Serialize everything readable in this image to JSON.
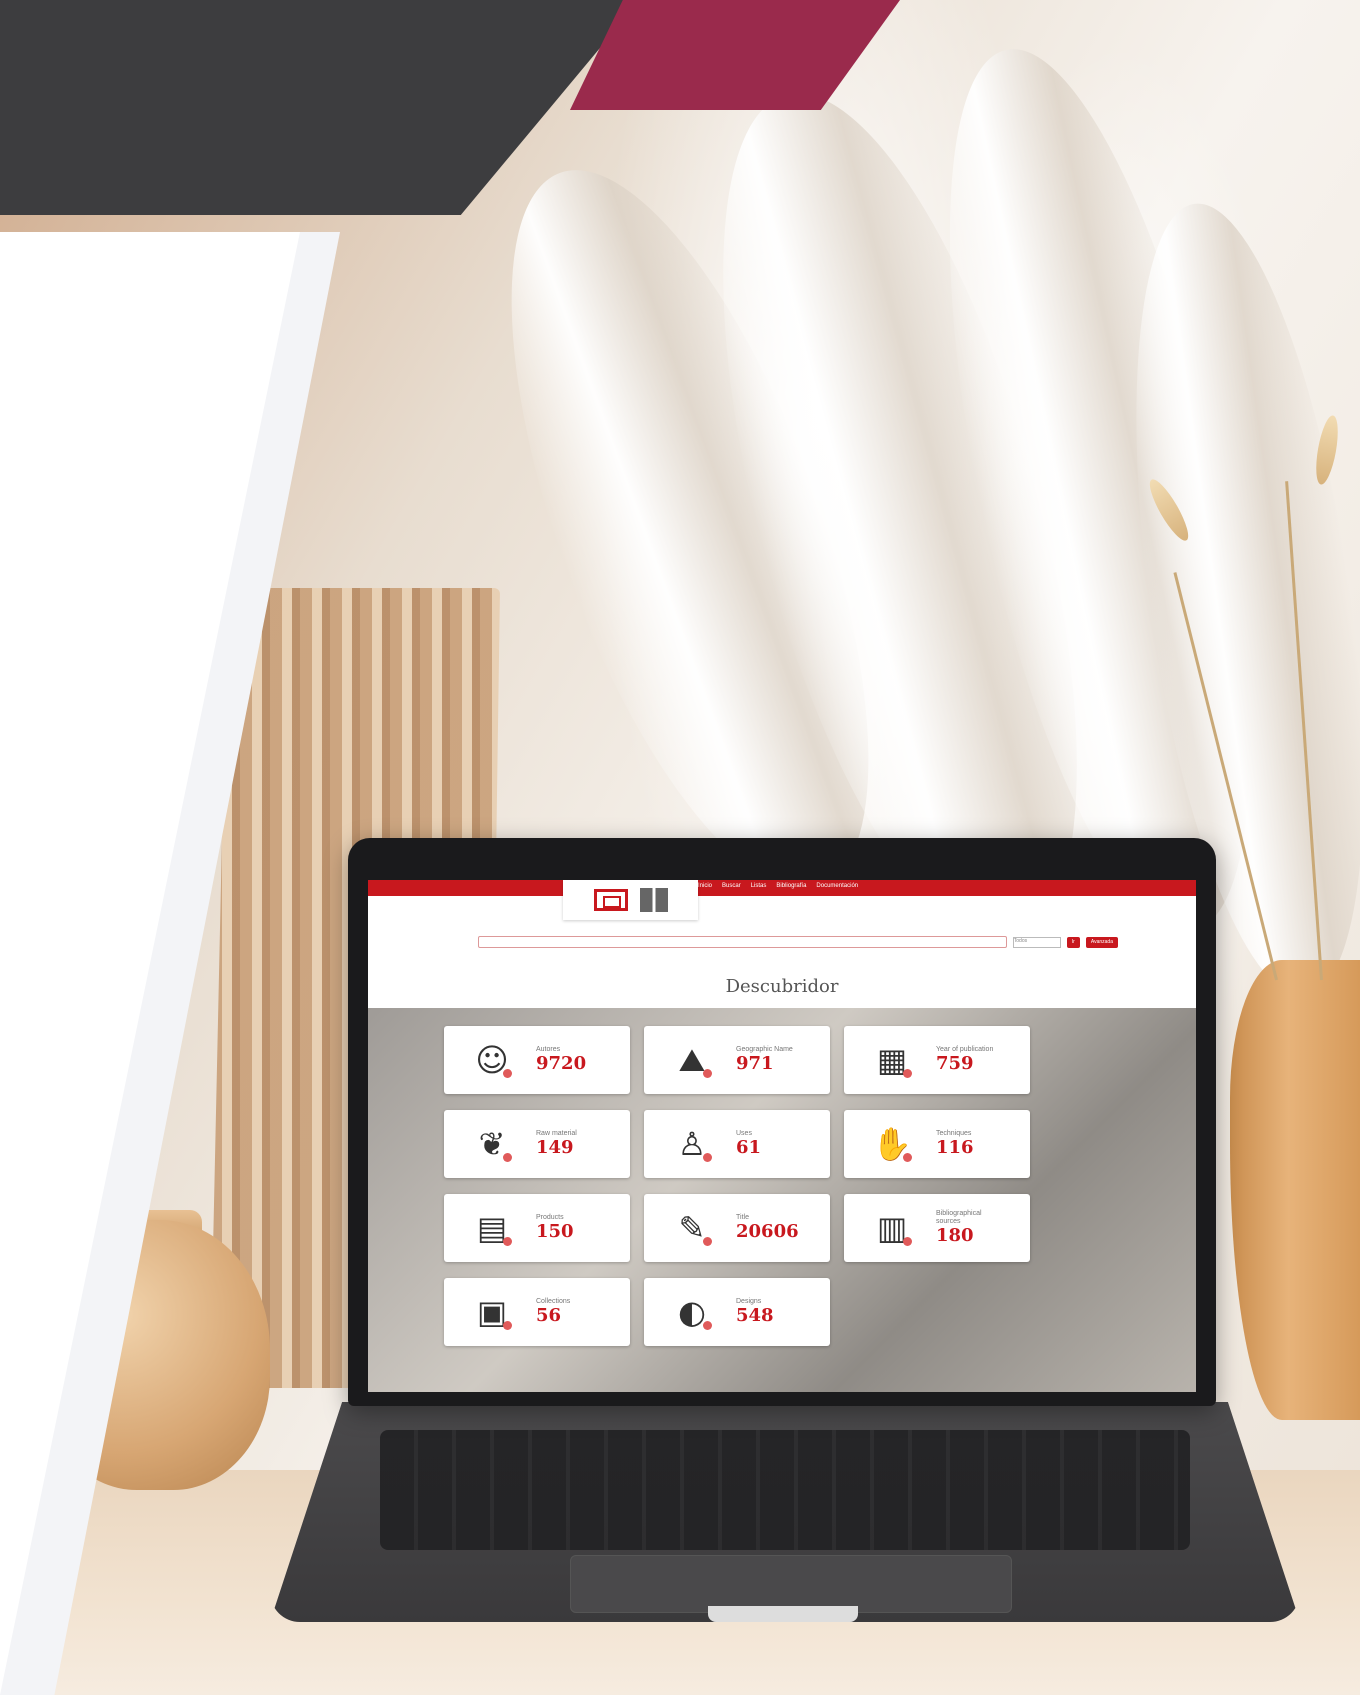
{
  "screen": {
    "nav_items": [
      "Inicio",
      "Buscar",
      "Listas",
      "Bibliografía",
      "Documentación"
    ],
    "search": {
      "select_value": "Todos",
      "search_button": "Ir",
      "advanced_button": "Avanzada"
    },
    "heading": "Descubridor",
    "cards": [
      {
        "icon": "person-icon",
        "glyph": "☺",
        "label": "Autores",
        "value": "9720"
      },
      {
        "icon": "map-icon",
        "glyph": "⛰",
        "label": "Geographic Name",
        "value": "971"
      },
      {
        "icon": "calendar-icon",
        "glyph": "▦",
        "label": "Year of publication",
        "value": "759"
      },
      {
        "icon": "plant-icon",
        "glyph": "❦",
        "label": "Raw material",
        "value": "149"
      },
      {
        "icon": "worker-icon",
        "glyph": "♙",
        "label": "Uses",
        "value": "61"
      },
      {
        "icon": "hands-icon",
        "glyph": "✋",
        "label": "Techniques",
        "value": "116"
      },
      {
        "icon": "loom-icon",
        "glyph": "▤",
        "label": "Products",
        "value": "150"
      },
      {
        "icon": "document-pen-icon",
        "glyph": "✎",
        "label": "Title",
        "value": "20606"
      },
      {
        "icon": "books-icon",
        "glyph": "▥",
        "label": "Bibliographical sources",
        "value": "180"
      },
      {
        "icon": "cabinet-icon",
        "glyph": "▣",
        "label": "Collections",
        "value": "56"
      },
      {
        "icon": "swatch-icon",
        "glyph": "◐",
        "label": "Designs",
        "value": "548"
      }
    ]
  },
  "colors": {
    "accent_red": "#c8181e",
    "dark_gray": "#3d3d3f",
    "wine": "#9a2a4c"
  }
}
